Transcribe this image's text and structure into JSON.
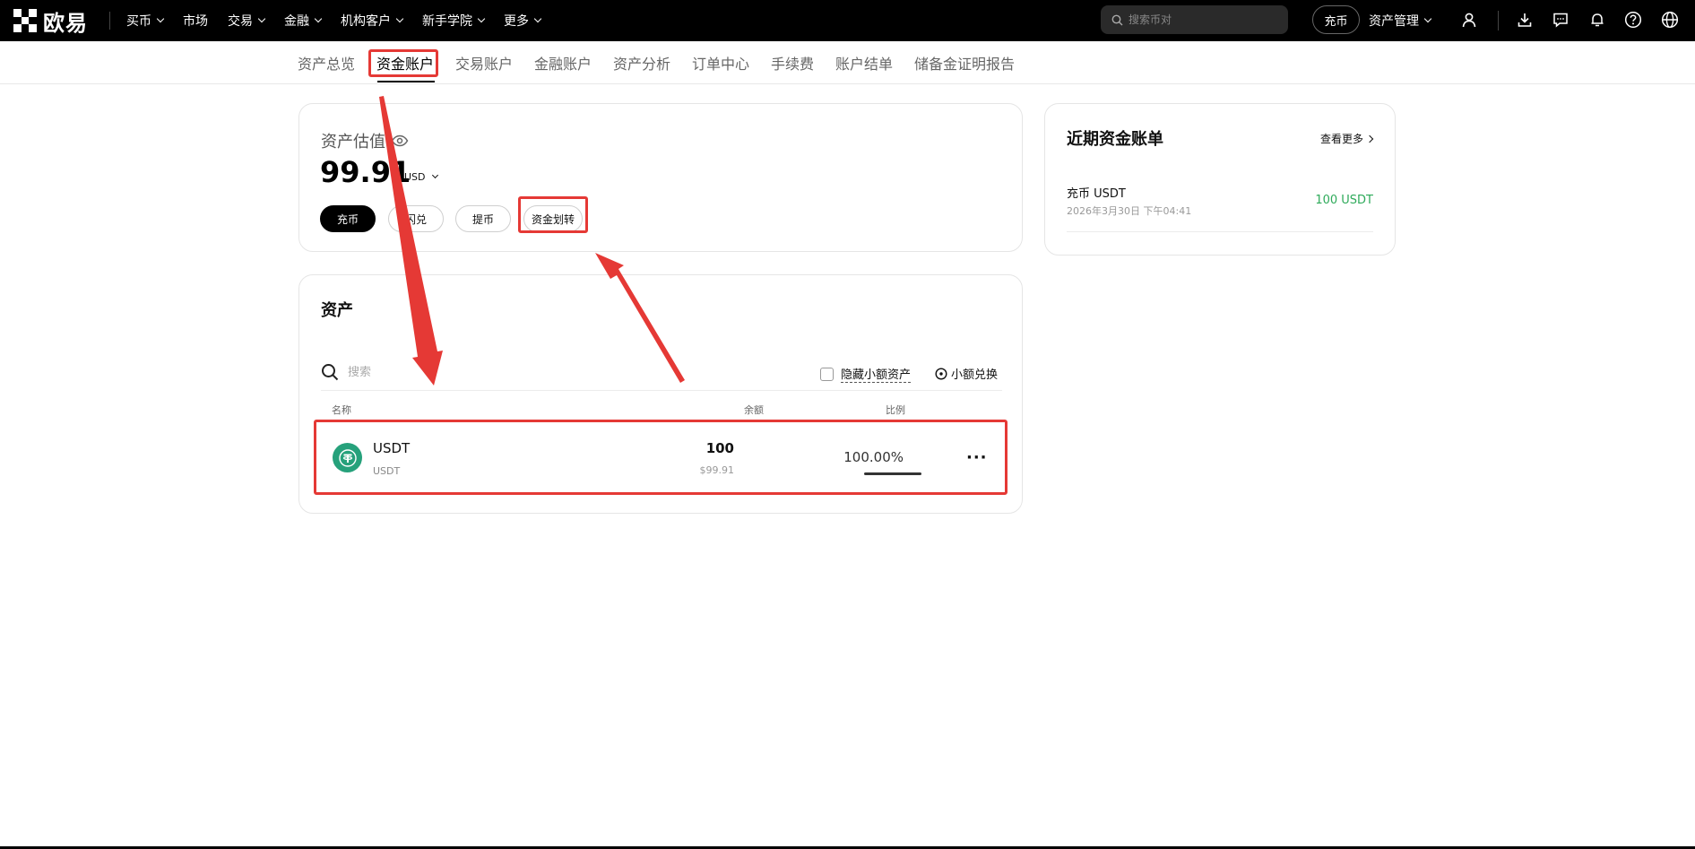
{
  "nav": {
    "brand": "欧易",
    "items": [
      {
        "label": "买币",
        "dropdown": true
      },
      {
        "label": "市场",
        "dropdown": false
      },
      {
        "label": "交易",
        "dropdown": true
      },
      {
        "label": "金融",
        "dropdown": true
      },
      {
        "label": "机构客户",
        "dropdown": true
      },
      {
        "label": "新手学院",
        "dropdown": true
      },
      {
        "label": "更多",
        "dropdown": true
      }
    ],
    "search_placeholder": "搜索币对",
    "deposit_label": "充币",
    "asset_manage_label": "资产管理"
  },
  "tabs": [
    {
      "label": "资产总览",
      "active": false
    },
    {
      "label": "资金账户",
      "active": true
    },
    {
      "label": "交易账户",
      "active": false
    },
    {
      "label": "金融账户",
      "active": false
    },
    {
      "label": "资产分析",
      "active": false
    },
    {
      "label": "订单中心",
      "active": false
    },
    {
      "label": "手续费",
      "active": false
    },
    {
      "label": "账户结单",
      "active": false
    },
    {
      "label": "储备金证明报告",
      "active": false
    }
  ],
  "valuation": {
    "label": "资产估值",
    "amount": "99.91",
    "currency": "USD",
    "buttons": {
      "deposit": "充币",
      "convert": "闪兑",
      "withdraw": "提币",
      "transfer": "资金划转"
    }
  },
  "assets": {
    "title": "资产",
    "search_placeholder": "搜索",
    "hide_small_label": "隐藏小额资产",
    "small_convert_label": "小额兑换",
    "columns": {
      "name": "名称",
      "balance": "余额",
      "ratio": "比例"
    },
    "rows": [
      {
        "name": "USDT",
        "sub": "USDT",
        "balance": "100",
        "balance_usd": "$99.91",
        "ratio": "100.00%",
        "ratio_value": 1.0,
        "more": "···"
      }
    ]
  },
  "recent": {
    "title": "近期资金账单",
    "more_label": "查看更多",
    "items": [
      {
        "name": "充币 USDT",
        "time": "2026年3月30日 下午04:41",
        "amount": "100 USDT"
      }
    ]
  },
  "colors": {
    "highlight": "#e53935",
    "positive": "#2eaa5a",
    "usdt": "#26a17b"
  }
}
